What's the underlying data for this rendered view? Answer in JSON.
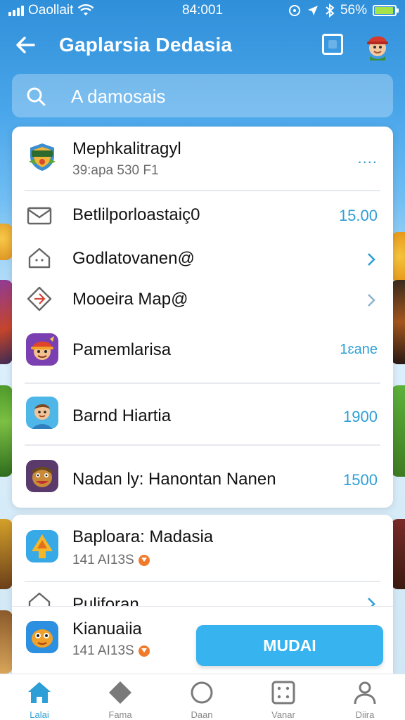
{
  "status_bar": {
    "carrier": "Oaollait",
    "time": "84:001",
    "battery": "56%"
  },
  "header": {
    "title": "Gaplarsia Dedasia"
  },
  "search": {
    "text": "A damosais"
  },
  "card": {
    "header_row": {
      "title": "Mephkalitragyl",
      "subtitle": "39:apa 530 F1",
      "more": "...."
    },
    "rows": [
      {
        "title": "Betlilporloastaiç0",
        "value": "15.00",
        "icon": "mail-icon"
      },
      {
        "title": "Godlatovanen@",
        "icon": "home-outline-icon"
      },
      {
        "title": "Mooeira Map@",
        "icon": "location-diamond-icon"
      },
      {
        "title": "Pamemlarisa",
        "value": "1ɛane",
        "icon": "game-app-icon"
      },
      {
        "title": "Barnd Hiartia",
        "value": "1900",
        "icon": "character-app-icon"
      },
      {
        "title": "Nadan ly: Hanontan Nanen",
        "value": "1500",
        "icon": "monster-app-icon"
      }
    ]
  },
  "card2": {
    "rows": [
      {
        "title": "Baploara: Madasia",
        "subtitle": "141 AI13S",
        "icon": "arrow-app-icon"
      },
      {
        "title": "Puliforan",
        "icon": "home-outline-icon"
      }
    ]
  },
  "sticky": {
    "title": "Kianuaiia",
    "subtitle": "141 AI13S",
    "button": "MUDAI"
  },
  "tabs": [
    {
      "label": "Lalai",
      "icon": "home-icon",
      "active": true
    },
    {
      "label": "Fama",
      "icon": "diamond-icon",
      "active": false
    },
    {
      "label": "Daan",
      "icon": "circle-icon",
      "active": false
    },
    {
      "label": "Vanar",
      "icon": "dice-icon",
      "active": false
    },
    {
      "label": "Diira",
      "icon": "person-icon",
      "active": false
    }
  ],
  "colors": {
    "accent": "#2e9fd6",
    "header_bg": "#2f8fd9",
    "button": "#37b3ef"
  }
}
